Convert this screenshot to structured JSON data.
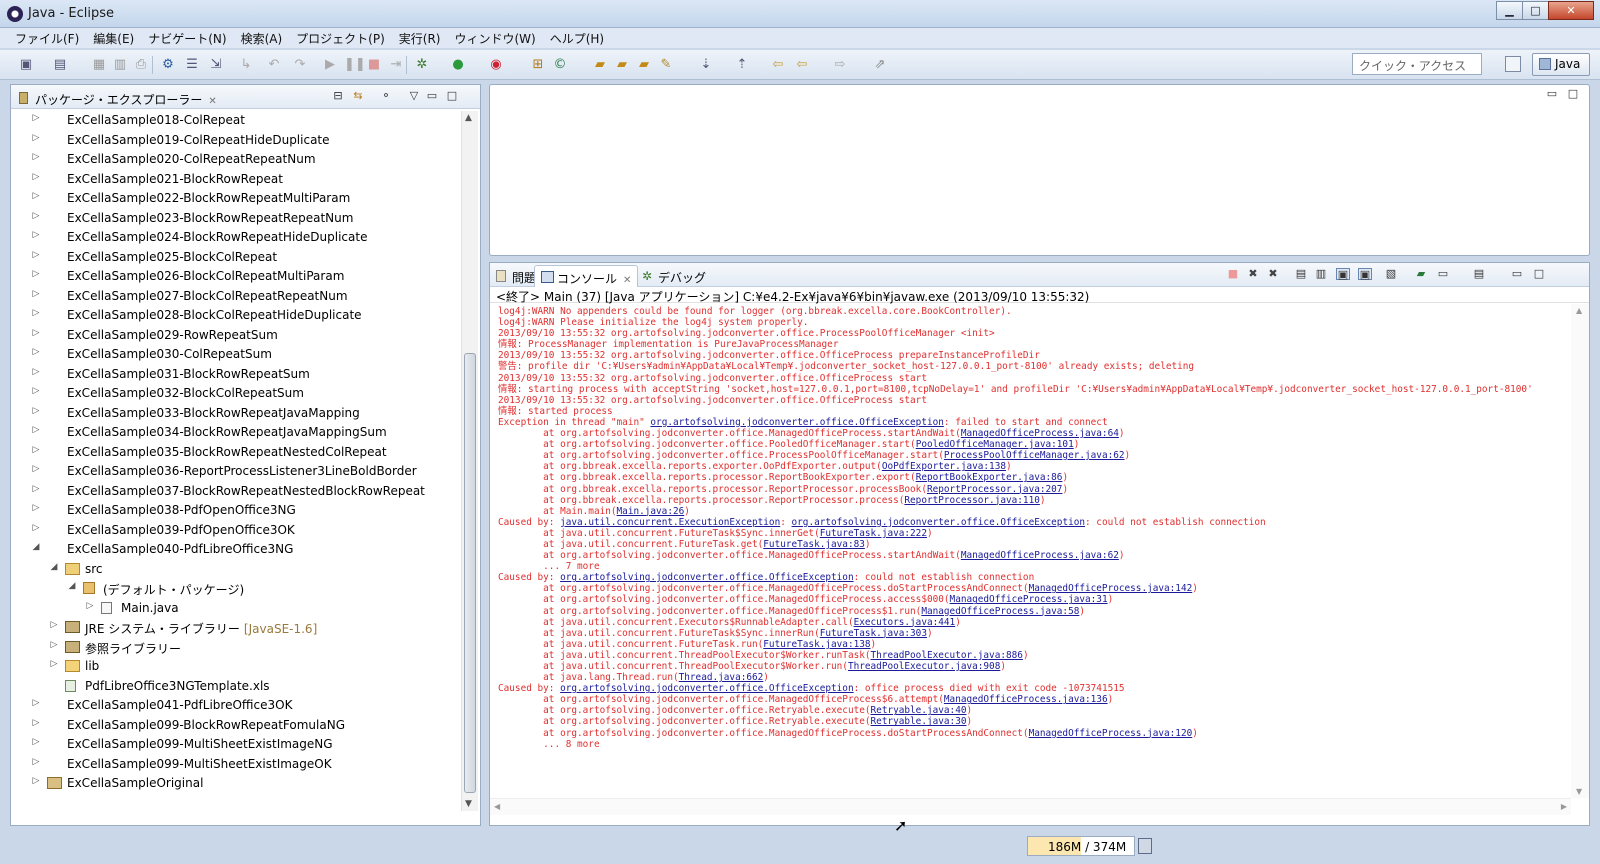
{
  "window": {
    "title": "Java - Eclipse",
    "minimize": "▁",
    "maximize": "□",
    "close": "✕"
  },
  "menu": [
    "ファイル(F)",
    "編集(E)",
    "ナビゲート(N)",
    "検索(A)",
    "プロジェクト(P)",
    "実行(R)",
    "ウィンドウ(W)",
    "ヘルプ(H)"
  ],
  "toolbar": {
    "quick_access_placeholder": "クイック・アクセス",
    "perspective_label": "Java"
  },
  "explorer": {
    "tab_label": "パッケージ・エクスプローラー",
    "items": [
      {
        "label": "ExCellaSample018-ColRepeat",
        "type": "project",
        "level": 0,
        "expander": "▷"
      },
      {
        "label": "ExCellaSample019-ColRepeatHideDuplicate",
        "type": "project",
        "level": 0,
        "expander": "▷"
      },
      {
        "label": "ExCellaSample020-ColRepeatRepeatNum",
        "type": "project",
        "level": 0,
        "expander": "▷"
      },
      {
        "label": "ExCellaSample021-BlockRowRepeat",
        "type": "project",
        "level": 0,
        "expander": "▷"
      },
      {
        "label": "ExCellaSample022-BlockRowRepeatMultiParam",
        "type": "project",
        "level": 0,
        "expander": "▷"
      },
      {
        "label": "ExCellaSample023-BlockRowRepeatRepeatNum",
        "type": "project",
        "level": 0,
        "expander": "▷"
      },
      {
        "label": "ExCellaSample024-BlockRowRepeatHideDuplicate",
        "type": "project",
        "level": 0,
        "expander": "▷"
      },
      {
        "label": "ExCellaSample025-BlockColRepeat",
        "type": "project",
        "level": 0,
        "expander": "▷"
      },
      {
        "label": "ExCellaSample026-BlockColRepeatMultiParam",
        "type": "project",
        "level": 0,
        "expander": "▷"
      },
      {
        "label": "ExCellaSample027-BlockColRepeatRepeatNum",
        "type": "project",
        "level": 0,
        "expander": "▷"
      },
      {
        "label": "ExCellaSample028-BlockColRepeatHideDuplicate",
        "type": "project",
        "level": 0,
        "expander": "▷"
      },
      {
        "label": "ExCellaSample029-RowRepeatSum",
        "type": "project",
        "level": 0,
        "expander": "▷"
      },
      {
        "label": "ExCellaSample030-ColRepeatSum",
        "type": "project",
        "level": 0,
        "expander": "▷"
      },
      {
        "label": "ExCellaSample031-BlockRowRepeatSum",
        "type": "project",
        "level": 0,
        "expander": "▷"
      },
      {
        "label": "ExCellaSample032-BlockColRepeatSum",
        "type": "project",
        "level": 0,
        "expander": "▷"
      },
      {
        "label": "ExCellaSample033-BlockRowRepeatJavaMapping",
        "type": "project",
        "level": 0,
        "expander": "▷"
      },
      {
        "label": "ExCellaSample034-BlockRowRepeatJavaMappingSum",
        "type": "project",
        "level": 0,
        "expander": "▷"
      },
      {
        "label": "ExCellaSample035-BlockRowRepeatNestedColRepeat",
        "type": "project",
        "level": 0,
        "expander": "▷"
      },
      {
        "label": "ExCellaSample036-ReportProcessListener3LineBoldBorder",
        "type": "project",
        "level": 0,
        "expander": "▷"
      },
      {
        "label": "ExCellaSample037-BlockRowRepeatNestedBlockRowRepeat",
        "type": "project",
        "level": 0,
        "expander": "▷"
      },
      {
        "label": "ExCellaSample038-PdfOpenOffice3NG",
        "type": "project",
        "level": 0,
        "expander": "▷"
      },
      {
        "label": "ExCellaSample039-PdfOpenOffice3OK",
        "type": "project",
        "level": 0,
        "expander": "▷"
      },
      {
        "label": "ExCellaSample040-PdfLibreOffice3NG",
        "type": "project",
        "level": 0,
        "expander": "◢"
      },
      {
        "label": "src",
        "type": "src",
        "level": 1,
        "expander": "◢"
      },
      {
        "label": "(デフォルト・パッケージ)",
        "type": "pkg",
        "level": 2,
        "expander": "◢"
      },
      {
        "label": "Main.java",
        "type": "file-java",
        "level": 3,
        "expander": "▷"
      },
      {
        "label": "JRE システム・ライブラリー",
        "deco": "[JavaSE-1.6]",
        "type": "lib",
        "level": 1,
        "expander": "▷"
      },
      {
        "label": "参照ライブラリー",
        "type": "lib",
        "level": 1,
        "expander": "▷"
      },
      {
        "label": "lib",
        "type": "folder",
        "level": 1,
        "expander": "▷"
      },
      {
        "label": "PdfLibreOffice3NGTemplate.xls",
        "type": "xls",
        "level": 1,
        "expander": ""
      },
      {
        "label": "ExCellaSample041-PdfLibreOffice3OK",
        "type": "project",
        "level": 0,
        "expander": "▷"
      },
      {
        "label": "ExCellaSample099-BlockRowRepeatFomulaNG",
        "type": "project",
        "level": 0,
        "expander": "▷"
      },
      {
        "label": "ExCellaSample099-MultiSheetExistImageNG",
        "type": "project",
        "level": 0,
        "expander": "▷"
      },
      {
        "label": "ExCellaSample099-MultiSheetExistImageOK",
        "type": "project",
        "level": 0,
        "expander": "▷"
      },
      {
        "label": "ExCellaSampleOriginal",
        "type": "orig",
        "level": 0,
        "expander": "▷"
      }
    ]
  },
  "console": {
    "tabs": [
      "問題",
      "コンソール",
      "デバッグ"
    ],
    "description": "<終了> Main (37) [Java アプリケーション] C:¥e4.2-Ex¥java¥6¥bin¥javaw.exe (2013/09/10 13:55:32)",
    "lines": [
      [
        {
          "t": "log4j:WARN No appenders could be found for logger (org.bbreak.excella.core.BookController)."
        }
      ],
      [
        {
          "t": "log4j:WARN Please initialize the log4j system properly."
        }
      ],
      [
        {
          "t": "2013/09/10 13:55:32 org.artofsolving.jodconverter.office.ProcessPoolOfficeManager <init>"
        }
      ],
      [
        {
          "t": "情報: ProcessManager implementation is PureJavaProcessManager"
        }
      ],
      [
        {
          "t": "2013/09/10 13:55:32 org.artofsolving.jodconverter.office.OfficeProcess prepareInstanceProfileDir"
        }
      ],
      [
        {
          "t": "警告: profile dir 'C:¥Users¥admin¥AppData¥Local¥Temp¥.jodconverter_socket_host-127.0.0.1_port-8100' already exists; deleting"
        }
      ],
      [
        {
          "t": "2013/09/10 13:55:32 org.artofsolving.jodconverter.office.OfficeProcess start"
        }
      ],
      [
        {
          "t": "情報: starting process with acceptString 'socket,host=127.0.0.1,port=8100,tcpNoDelay=1' and profileDir 'C:¥Users¥admin¥AppData¥Local¥Temp¥.jodconverter_socket_host-127.0.0.1_port-8100'"
        }
      ],
      [
        {
          "t": "2013/09/10 13:55:32 org.artofsolving.jodconverter.office.OfficeProcess start"
        }
      ],
      [
        {
          "t": "情報: started process"
        }
      ],
      [
        {
          "t": "Exception in thread \"main\" "
        },
        {
          "t": "org.artofsolving.jodconverter.office.OfficeException",
          "l": 1
        },
        {
          "t": ": failed to start and connect"
        }
      ],
      [
        {
          "t": "        at org.artofsolving.jodconverter.office.ManagedOfficeProcess.startAndWait("
        },
        {
          "t": "ManagedOfficeProcess.java:64",
          "l": 1
        },
        {
          "t": ")"
        }
      ],
      [
        {
          "t": "        at org.artofsolving.jodconverter.office.PooledOfficeManager.start("
        },
        {
          "t": "PooledOfficeManager.java:101",
          "l": 1
        },
        {
          "t": ")"
        }
      ],
      [
        {
          "t": "        at org.artofsolving.jodconverter.office.ProcessPoolOfficeManager.start("
        },
        {
          "t": "ProcessPoolOfficeManager.java:62",
          "l": 1
        },
        {
          "t": ")"
        }
      ],
      [
        {
          "t": "        at org.bbreak.excella.reports.exporter.OoPdfExporter.output("
        },
        {
          "t": "OoPdfExporter.java:138",
          "l": 1
        },
        {
          "t": ")"
        }
      ],
      [
        {
          "t": "        at org.bbreak.excella.reports.processor.ReportBookExporter.export("
        },
        {
          "t": "ReportBookExporter.java:86",
          "l": 1
        },
        {
          "t": ")"
        }
      ],
      [
        {
          "t": "        at org.bbreak.excella.reports.processor.ReportProcessor.processBook("
        },
        {
          "t": "ReportProcessor.java:207",
          "l": 1
        },
        {
          "t": ")"
        }
      ],
      [
        {
          "t": "        at org.bbreak.excella.reports.processor.ReportProcessor.process("
        },
        {
          "t": "ReportProcessor.java:110",
          "l": 1
        },
        {
          "t": ")"
        }
      ],
      [
        {
          "t": "        at Main.main("
        },
        {
          "t": "Main.java:26",
          "l": 1
        },
        {
          "t": ")"
        }
      ],
      [
        {
          "t": "Caused by: "
        },
        {
          "t": "java.util.concurrent.ExecutionException",
          "l": 1
        },
        {
          "t": ": "
        },
        {
          "t": "org.artofsolving.jodconverter.office.OfficeException",
          "l": 1
        },
        {
          "t": ": could not establish connection"
        }
      ],
      [
        {
          "t": "        at java.util.concurrent.FutureTask$Sync.innerGet("
        },
        {
          "t": "FutureTask.java:222",
          "l": 1
        },
        {
          "t": ")"
        }
      ],
      [
        {
          "t": "        at java.util.concurrent.FutureTask.get("
        },
        {
          "t": "FutureTask.java:83",
          "l": 1
        },
        {
          "t": ")"
        }
      ],
      [
        {
          "t": "        at org.artofsolving.jodconverter.office.ManagedOfficeProcess.startAndWait("
        },
        {
          "t": "ManagedOfficeProcess.java:62",
          "l": 1
        },
        {
          "t": ")"
        }
      ],
      [
        {
          "t": "        ... 7 more"
        }
      ],
      [
        {
          "t": "Caused by: "
        },
        {
          "t": "org.artofsolving.jodconverter.office.OfficeException",
          "l": 1
        },
        {
          "t": ": could not establish connection"
        }
      ],
      [
        {
          "t": "        at org.artofsolving.jodconverter.office.ManagedOfficeProcess.doStartProcessAndConnect("
        },
        {
          "t": "ManagedOfficeProcess.java:142",
          "l": 1
        },
        {
          "t": ")"
        }
      ],
      [
        {
          "t": "        at org.artofsolving.jodconverter.office.ManagedOfficeProcess.access$000("
        },
        {
          "t": "ManagedOfficeProcess.java:31",
          "l": 1
        },
        {
          "t": ")"
        }
      ],
      [
        {
          "t": "        at org.artofsolving.jodconverter.office.ManagedOfficeProcess$1.run("
        },
        {
          "t": "ManagedOfficeProcess.java:58",
          "l": 1
        },
        {
          "t": ")"
        }
      ],
      [
        {
          "t": "        at java.util.concurrent.Executors$RunnableAdapter.call("
        },
        {
          "t": "Executors.java:441",
          "l": 1
        },
        {
          "t": ")"
        }
      ],
      [
        {
          "t": "        at java.util.concurrent.FutureTask$Sync.innerRun("
        },
        {
          "t": "FutureTask.java:303",
          "l": 1
        },
        {
          "t": ")"
        }
      ],
      [
        {
          "t": "        at java.util.concurrent.FutureTask.run("
        },
        {
          "t": "FutureTask.java:138",
          "l": 1
        },
        {
          "t": ")"
        }
      ],
      [
        {
          "t": "        at java.util.concurrent.ThreadPoolExecutor$Worker.runTask("
        },
        {
          "t": "ThreadPoolExecutor.java:886",
          "l": 1
        },
        {
          "t": ")"
        }
      ],
      [
        {
          "t": "        at java.util.concurrent.ThreadPoolExecutor$Worker.run("
        },
        {
          "t": "ThreadPoolExecutor.java:908",
          "l": 1
        },
        {
          "t": ")"
        }
      ],
      [
        {
          "t": "        at java.lang.Thread.run("
        },
        {
          "t": "Thread.java:662",
          "l": 1
        },
        {
          "t": ")"
        }
      ],
      [
        {
          "t": "Caused by: "
        },
        {
          "t": "org.artofsolving.jodconverter.office.OfficeException",
          "l": 1
        },
        {
          "t": ": office process died with exit code -1073741515"
        }
      ],
      [
        {
          "t": "        at org.artofsolving.jodconverter.office.ManagedOfficeProcess$6.attempt("
        },
        {
          "t": "ManagedOfficeProcess.java:136",
          "l": 1
        },
        {
          "t": ")"
        }
      ],
      [
        {
          "t": "        at org.artofsolving.jodconverter.office.Retryable.execute("
        },
        {
          "t": "Retryable.java:40",
          "l": 1
        },
        {
          "t": ")"
        }
      ],
      [
        {
          "t": "        at org.artofsolving.jodconverter.office.Retryable.execute("
        },
        {
          "t": "Retryable.java:30",
          "l": 1
        },
        {
          "t": ")"
        }
      ],
      [
        {
          "t": "        at org.artofsolving.jodconverter.office.ManagedOfficeProcess.doStartProcessAndConnect("
        },
        {
          "t": "ManagedOfficeProcess.java:120",
          "l": 1
        },
        {
          "t": ")"
        }
      ],
      [
        {
          "t": "        ... 8 more"
        }
      ]
    ]
  },
  "status": {
    "heap": "186M / 374M",
    "heap_used_fraction": 0.497
  },
  "colors": {
    "error_text": "#e03030",
    "link_text": "#1b1b9a",
    "chrome": "#c9d7e8"
  }
}
